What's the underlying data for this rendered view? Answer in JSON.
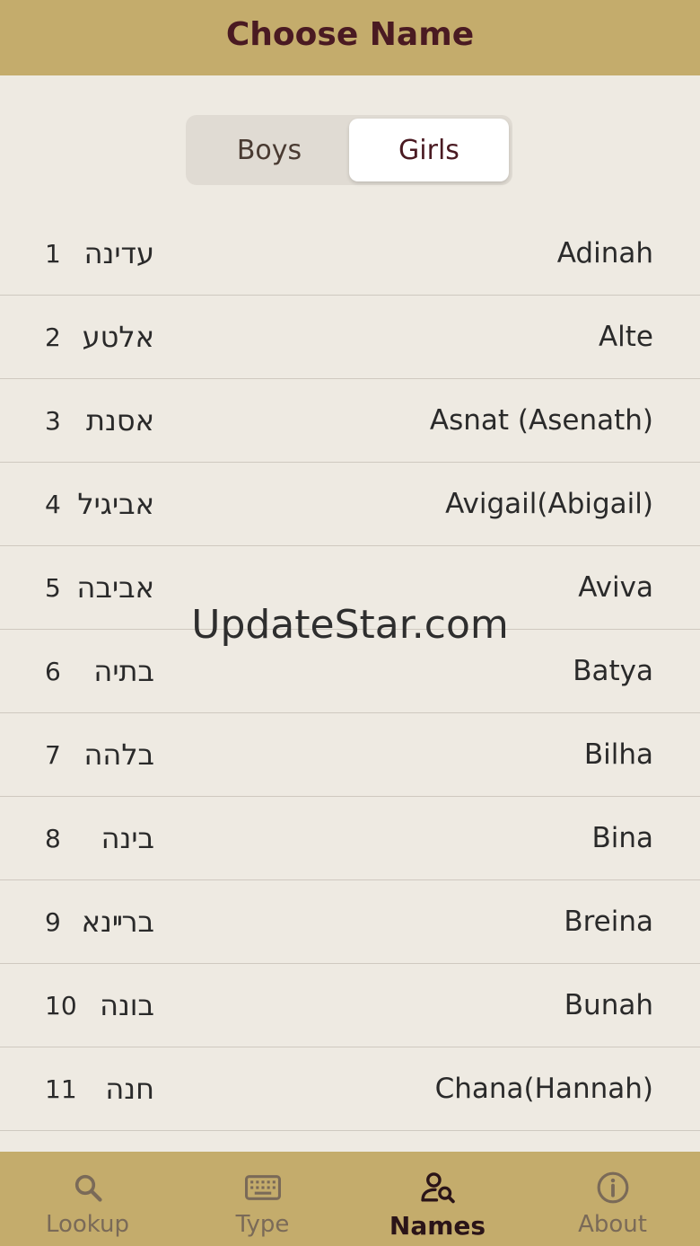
{
  "header": {
    "title": "Choose Name"
  },
  "segments": {
    "boys": "Boys",
    "girls": "Girls",
    "selected": "Girls"
  },
  "names": [
    {
      "num": "1",
      "hebrew": "עדינה",
      "english": "Adinah"
    },
    {
      "num": "2",
      "hebrew": "אלטע",
      "english": "Alte"
    },
    {
      "num": "3",
      "hebrew": "אסנת",
      "english": "Asnat (Asenath)"
    },
    {
      "num": "4",
      "hebrew": "אביגיל",
      "english": "Avigail(Abigail)"
    },
    {
      "num": "5",
      "hebrew": "אביבה",
      "english": "Aviva"
    },
    {
      "num": "6",
      "hebrew": "בתיה",
      "english": "Batya"
    },
    {
      "num": "7",
      "hebrew": "בלהה",
      "english": "Bilha"
    },
    {
      "num": "8",
      "hebrew": "בינה",
      "english": "Bina"
    },
    {
      "num": "9",
      "hebrew": "ברײנא",
      "english": "Breina"
    },
    {
      "num": "10",
      "hebrew": "בונה",
      "english": "Bunah"
    },
    {
      "num": "11",
      "hebrew": "חנה",
      "english": "Chana(Hannah)"
    }
  ],
  "watermark": "UpdateStar.com",
  "tabs": [
    {
      "label": "Lookup",
      "icon": "search-icon"
    },
    {
      "label": "Type",
      "icon": "keyboard-icon"
    },
    {
      "label": "Names",
      "icon": "person-search-icon",
      "active": true
    },
    {
      "label": "About",
      "icon": "info-icon"
    }
  ],
  "colors": {
    "header_bg": "#c4ac6c",
    "title_color": "#4a1a22",
    "background": "#eeeae2",
    "divider": "#cfc9c0"
  }
}
